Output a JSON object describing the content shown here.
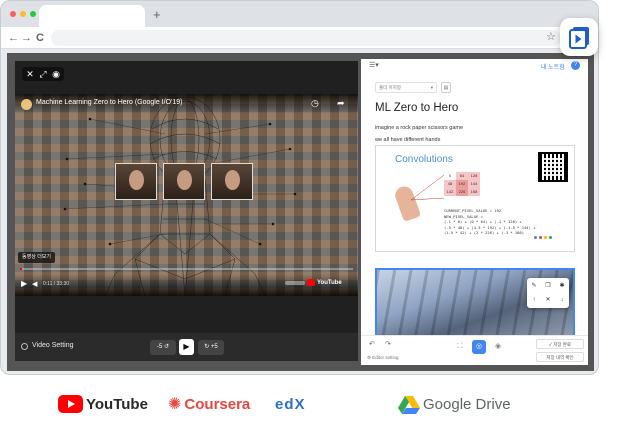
{
  "browser": {
    "new_tab_glyph": "+",
    "nav": {
      "back": "←",
      "forward": "→",
      "reload": "C"
    },
    "bookmark_icon": "star-icon"
  },
  "player": {
    "top_controls": [
      "close-icon",
      "expand-icon",
      "eye-icon"
    ],
    "video": {
      "title": "Machine Learning Zero to Hero (Google I/O'19)",
      "badge": "동영상 더보기",
      "time": "0:11 / 33:30",
      "platform": "YouTube"
    },
    "footer": {
      "setting_label": "Video Setting",
      "rewind_label": "-5",
      "forward_label": "+5"
    }
  },
  "notes": {
    "header_link": "내 노트함",
    "help": "?",
    "select_value": "폴더 미지정",
    "title": "ML Zero to Hero",
    "lines": [
      "imagine a rock paper scissors game",
      "we all have different hands"
    ],
    "slide": {
      "title": "Convolutions",
      "grid": [
        "0",
        "64",
        "128",
        "48",
        "192",
        "144",
        "142",
        "226",
        "168"
      ],
      "code": "CURRENT_PIXEL_VALUE = 192\nNEW_PIXEL_VALUE =\n(-1 * 0) + (0 * 64) + (-1 * 128) +\n(.5 * 48) + (4.5 * 192) + (-1.5 * 144) +\n(1.5 * 42) + (2 * 226) + (-3 * 168)"
    },
    "footer": {
      "editor_setting": "Editor setting",
      "save_label": "저장 완료",
      "list_label": "저장 내역 확인"
    }
  },
  "partners": [
    {
      "name": "YouTube",
      "color": "#282828",
      "accent": "#ff0000"
    },
    {
      "name": "Coursera",
      "color": "#e8473f"
    },
    {
      "name": "edX",
      "color": "#2d6fc4"
    },
    {
      "name": "Google Drive",
      "color": "#5f6368"
    }
  ]
}
